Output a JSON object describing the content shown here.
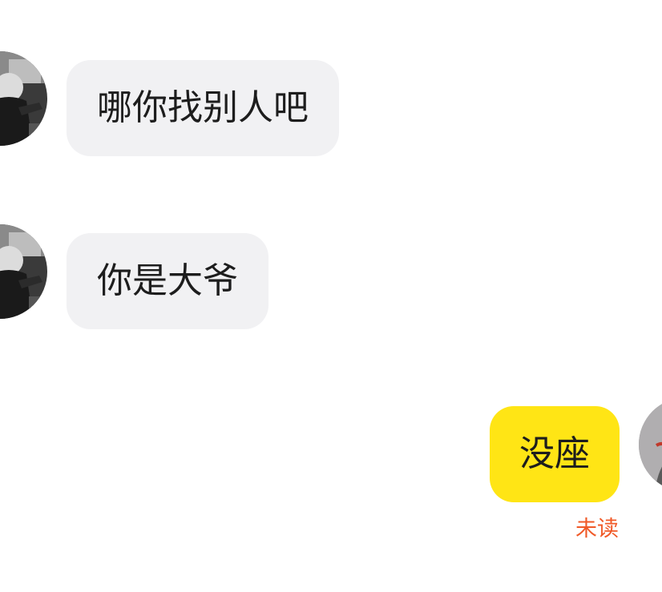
{
  "messages": [
    {
      "direction": "incoming",
      "text": "哪你找别人吧",
      "avatar_icon": "user-avatar-icon"
    },
    {
      "direction": "incoming",
      "text": "你是大爷",
      "avatar_icon": "user-avatar-icon"
    },
    {
      "direction": "outgoing",
      "text": "没座",
      "status": "未读",
      "avatar_icon": "self-avatar-icon"
    }
  ],
  "colors": {
    "incoming_bubble": "#f1f1f3",
    "outgoing_bubble": "#ffe515",
    "unread_status": "#f05a28",
    "text": "#1d1d1d"
  }
}
